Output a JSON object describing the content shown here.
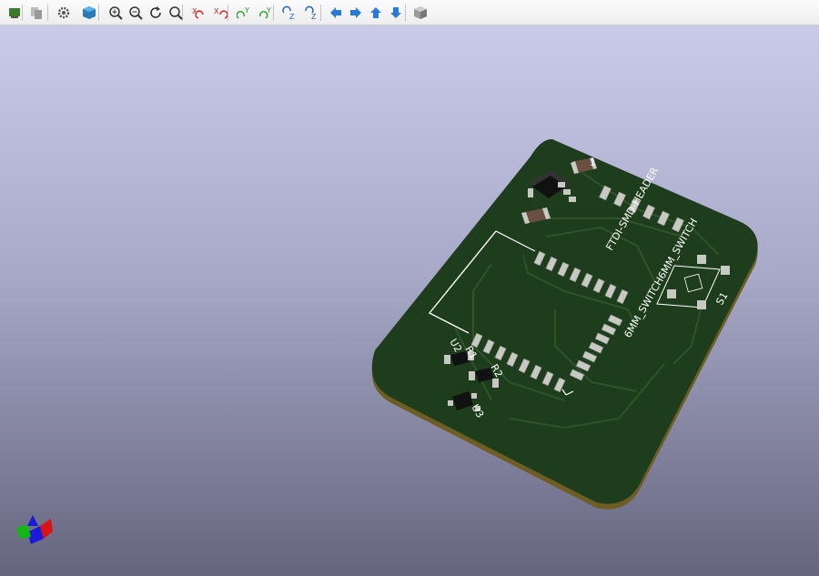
{
  "toolbar": {
    "buttons": [
      {
        "name": "reload-board-icon",
        "color": "#3a7a2a"
      },
      {
        "name": "copy-to-clipboard-icon",
        "color": "#8a8a8a"
      },
      {
        "name": "preferences-gear-icon",
        "color": "#555555"
      },
      {
        "name": "raytracing-cube-icon",
        "color": "#2a7ab8"
      },
      {
        "name": "zoom-in-icon",
        "color": "#333333"
      },
      {
        "name": "zoom-out-icon",
        "color": "#333333"
      },
      {
        "name": "redraw-icon",
        "color": "#333333"
      },
      {
        "name": "zoom-fit-icon",
        "color": "#333333"
      },
      {
        "name": "rotate-x-cw-icon",
        "color": "#d02020"
      },
      {
        "name": "rotate-x-ccw-icon",
        "color": "#d02020"
      },
      {
        "name": "rotate-y-cw-icon",
        "color": "#2a9a2a"
      },
      {
        "name": "rotate-y-ccw-icon",
        "color": "#2a9a2a"
      },
      {
        "name": "rotate-z-cw-icon",
        "color": "#2060c0"
      },
      {
        "name": "rotate-z-ccw-icon",
        "color": "#2060c0"
      },
      {
        "name": "pan-left-icon",
        "color": "#2a78d8"
      },
      {
        "name": "pan-right-icon",
        "color": "#2a78d8"
      },
      {
        "name": "pan-up-icon",
        "color": "#2a78d8"
      },
      {
        "name": "pan-down-icon",
        "color": "#2a78d8"
      },
      {
        "name": "ortho-view-cube-icon",
        "color": "#777777"
      }
    ]
  },
  "board": {
    "colors": {
      "soldermask": "#1d3d1c",
      "edge": "#7a6a2a",
      "trace": "#2e552a",
      "pad": "#c9c9c4",
      "silkscreen": "#ffffff"
    },
    "labels": {
      "ftdi": "FTDI-SMD-HEADER",
      "switch": "6MM_SWITCH6MM_SWITCH",
      "s1": "S1",
      "r1": "R1",
      "r2": "R2",
      "u2": "U2",
      "u3": "U3",
      "j1_pin": "1"
    }
  },
  "axis_indicator": {
    "x_color": "#d01010",
    "y_color": "#10a010",
    "z_color": "#1010d0"
  }
}
